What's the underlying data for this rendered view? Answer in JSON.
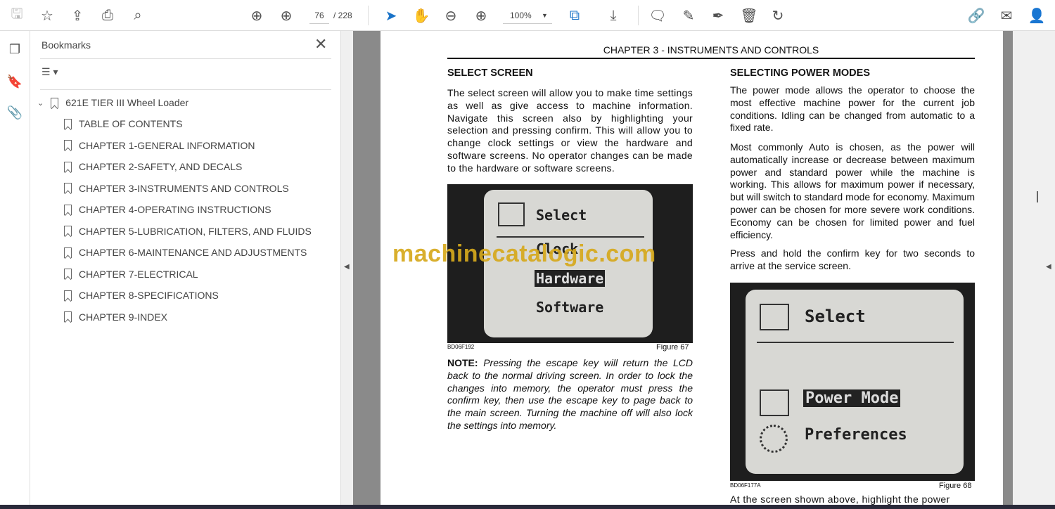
{
  "toolbar": {
    "page_current": "76",
    "page_total": "/ 228",
    "zoom": "100%"
  },
  "bookmarks": {
    "title": "Bookmarks",
    "root": "621E TIER III Wheel Loader",
    "items": [
      "TABLE OF CONTENTS",
      "CHAPTER 1-GENERAL INFORMATION",
      "CHAPTER 2-SAFETY, AND DECALS",
      "CHAPTER 3-INSTRUMENTS AND CONTROLS",
      "CHAPTER 4-OPERATING INSTRUCTIONS",
      "CHAPTER 5-LUBRICATION, FILTERS, AND FLUIDS",
      "CHAPTER 6-MAINTENANCE AND ADJUSTMENTS",
      "CHAPTER 7-ELECTRICAL",
      "CHAPTER 8-SPECIFICATIONS",
      "CHAPTER 9-INDEX"
    ]
  },
  "doc": {
    "header": "CHAPTER 3 - INSTRUMENTS AND CONTROLS",
    "left_heading": "SELECT SCREEN",
    "left_para": "The select screen will allow you to make time settings as well as give access to machine information. Navigate this screen also by highlighting your selection and pressing confirm. This will allow you to change clock settings or view the hardware and software screens. No operator changes can be made to the hardware or software screens.",
    "fig1": {
      "title": "Select",
      "items": [
        "Clock",
        "Hardware",
        "Software"
      ],
      "code": "BD06F192",
      "caption": "Figure 67"
    },
    "note_label": "NOTE:",
    "note_text": "Pressing the escape key will return the LCD back to the normal driving screen. In order to lock the changes into memory, the operator must press the confirm key, then use the escape key to page back to the main screen. Turning the machine off will also lock the settings into memory.",
    "right_heading": "SELECTING POWER MODES",
    "right_p1": "The power mode allows the operator to choose the most effective machine power for the current job conditions. Idling can be changed from automatic to a fixed rate.",
    "right_p2": "Most commonly Auto is chosen, as the power will automatically increase or decrease between maximum power and standard power while the machine is working. This allows for maximum power if necessary, but will switch to standard mode for economy. Maximum power can be chosen for more severe work conditions. Economy can be chosen for limited power and fuel efficiency.",
    "right_p3": "Press and hold the confirm key for two seconds to arrive at the service screen.",
    "fig2": {
      "title": "Select",
      "items": [
        "Power Mode",
        "Preferences"
      ],
      "code": "BD06F177A",
      "caption": "Figure 68"
    },
    "right_p4": "At the screen shown above, highlight the power"
  },
  "watermark": "machinecatalogic.com"
}
